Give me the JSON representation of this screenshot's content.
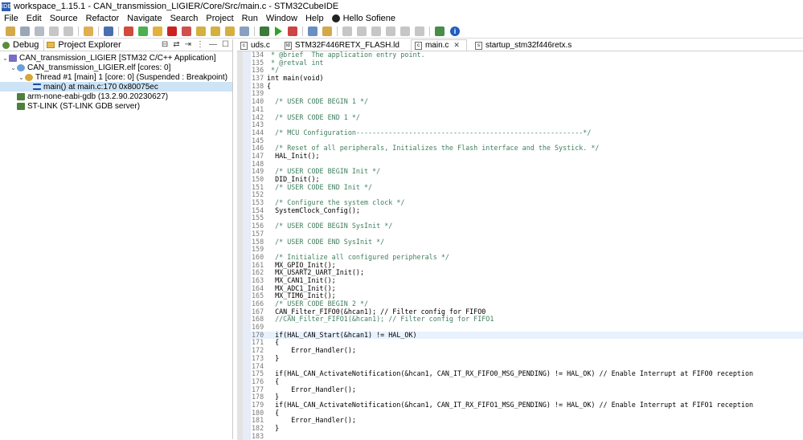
{
  "window": {
    "title": "workspace_1.15.1 - CAN_transmission_LIGIER/Core/Src/main.c - STM32CubeIDE",
    "app_icon_text": "IDE"
  },
  "menu": {
    "items": [
      "File",
      "Edit",
      "Source",
      "Refactor",
      "Navigate",
      "Search",
      "Project",
      "Run",
      "Window",
      "Help"
    ],
    "user_label": "Hello Sofiene"
  },
  "left_panel": {
    "tabs": [
      {
        "label": "Debug"
      },
      {
        "label": "Project Explorer"
      }
    ],
    "tree": [
      {
        "text": "CAN_transmission_LIGIER [STM32 C/C++ Application]"
      },
      {
        "text": "CAN_transmission_LIGIER.elf [cores: 0]"
      },
      {
        "text": "Thread #1 [main] 1 [core: 0] (Suspended : Breakpoint)"
      },
      {
        "text": "main() at main.c:170 0x80075ec"
      },
      {
        "text": "arm-none-eabi-gdb (13.2.90.20230627)"
      },
      {
        "text": "ST-LINK (ST-LINK GDB server)"
      }
    ]
  },
  "editor": {
    "tabs": [
      {
        "label": "uds.c"
      },
      {
        "label": "STM32F446RETX_FLASH.ld"
      },
      {
        "label": "main.c"
      },
      {
        "label": "startup_stm32f446retx.s"
      }
    ],
    "lines": [
      {
        "n": "134",
        "t": " * @brief  The application entry point."
      },
      {
        "n": "135",
        "t": " * @retval int"
      },
      {
        "n": "136",
        "t": " */"
      },
      {
        "n": "137",
        "t": "int main(void)"
      },
      {
        "n": "138",
        "t": "{"
      },
      {
        "n": "139",
        "t": ""
      },
      {
        "n": "140",
        "t": "  /* USER CODE BEGIN 1 */"
      },
      {
        "n": "141",
        "t": ""
      },
      {
        "n": "142",
        "t": "  /* USER CODE END 1 */"
      },
      {
        "n": "143",
        "t": ""
      },
      {
        "n": "144",
        "t": "  /* MCU Configuration--------------------------------------------------------*/"
      },
      {
        "n": "145",
        "t": ""
      },
      {
        "n": "146",
        "t": "  /* Reset of all peripherals, Initializes the Flash interface and the Systick. */"
      },
      {
        "n": "147",
        "t": "  HAL_Init();"
      },
      {
        "n": "148",
        "t": ""
      },
      {
        "n": "149",
        "t": "  /* USER CODE BEGIN Init */"
      },
      {
        "n": "150",
        "t": "  DID_Init();"
      },
      {
        "n": "151",
        "t": "  /* USER CODE END Init */"
      },
      {
        "n": "152",
        "t": ""
      },
      {
        "n": "153",
        "t": "  /* Configure the system clock */"
      },
      {
        "n": "154",
        "t": "  SystemClock_Config();"
      },
      {
        "n": "155",
        "t": ""
      },
      {
        "n": "156",
        "t": "  /* USER CODE BEGIN SysInit */"
      },
      {
        "n": "157",
        "t": ""
      },
      {
        "n": "158",
        "t": "  /* USER CODE END SysInit */"
      },
      {
        "n": "159",
        "t": ""
      },
      {
        "n": "160",
        "t": "  /* Initialize all configured peripherals */"
      },
      {
        "n": "161",
        "t": "  MX_GPIO_Init();"
      },
      {
        "n": "162",
        "t": "  MX_USART2_UART_Init();"
      },
      {
        "n": "163",
        "t": "  MX_CAN1_Init();"
      },
      {
        "n": "164",
        "t": "  MX_ADC1_Init();"
      },
      {
        "n": "165",
        "t": "  MX_TIM6_Init();"
      },
      {
        "n": "166",
        "t": "  /* USER CODE BEGIN 2 */"
      },
      {
        "n": "167",
        "t": "  CAN_Filter_FIFO0(&hcan1); // Filter config for FIFO0"
      },
      {
        "n": "168",
        "t": "  //CAN_Filter_FIFO1(&hcan1); // Filter config for FIFO1"
      },
      {
        "n": "169",
        "t": ""
      },
      {
        "n": "170",
        "t": "  if(HAL_CAN_Start(&hcan1) != HAL_OK)"
      },
      {
        "n": "171",
        "t": "  {"
      },
      {
        "n": "172",
        "t": "      Error_Handler();"
      },
      {
        "n": "173",
        "t": "  }"
      },
      {
        "n": "174",
        "t": ""
      },
      {
        "n": "175",
        "t": "  if(HAL_CAN_ActivateNotification(&hcan1, CAN_IT_RX_FIFO0_MSG_PENDING) != HAL_OK) // Enable Interrupt at FIFO0 reception"
      },
      {
        "n": "176",
        "t": "  {"
      },
      {
        "n": "177",
        "t": "      Error_Handler();"
      },
      {
        "n": "178",
        "t": "  }"
      },
      {
        "n": "179",
        "t": "  if(HAL_CAN_ActivateNotification(&hcan1, CAN_IT_RX_FIFO1_MSG_PENDING) != HAL_OK) // Enable Interrupt at FIFO1 reception"
      },
      {
        "n": "180",
        "t": "  {"
      },
      {
        "n": "181",
        "t": "      Error_Handler();"
      },
      {
        "n": "182",
        "t": "  }"
      },
      {
        "n": "183",
        "t": ""
      }
    ]
  },
  "colors": {
    "selection": "#cde4f7",
    "current_line": "#e8f2fe",
    "comment": "#3f7f5f",
    "keyword": "#7f0055"
  }
}
